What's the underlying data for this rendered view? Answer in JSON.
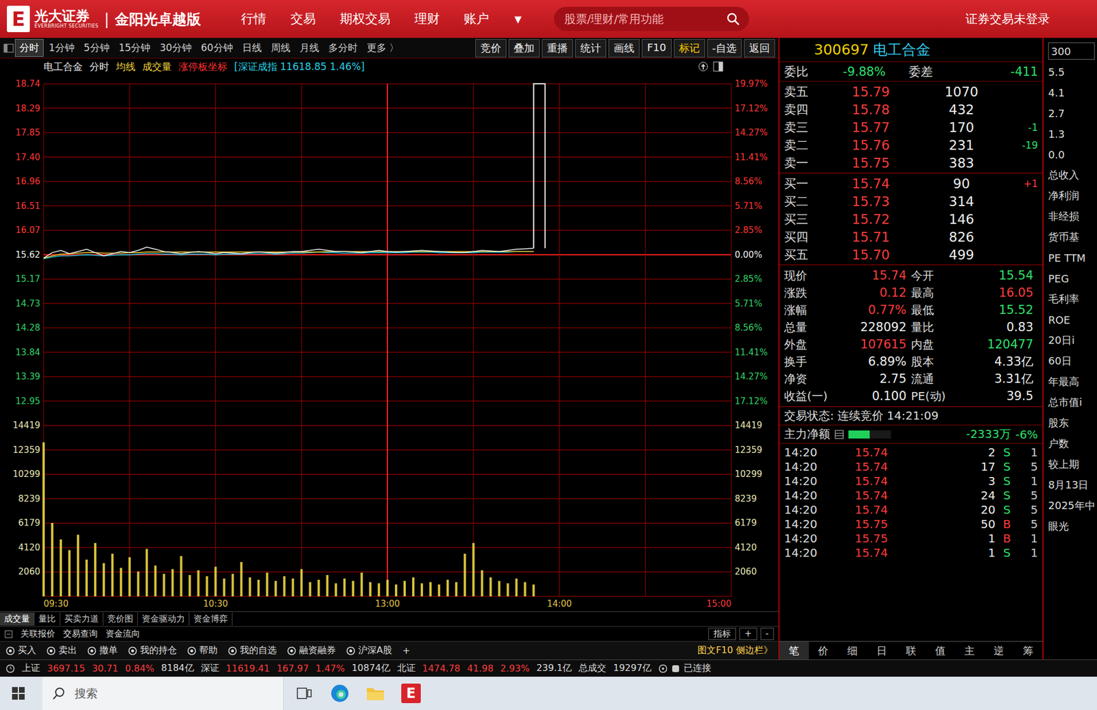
{
  "header": {
    "logo": "E",
    "brand": "光大证券",
    "brand_en": "EVERBRIGHT SECURITIES",
    "separator": "|",
    "edition": "金阳光卓越版",
    "menu": [
      "行情",
      "交易",
      "期权交易",
      "理财",
      "账户"
    ],
    "menu_arrow": "▼",
    "search": {
      "placeholder": "股票/理财/常用功能"
    },
    "login_status": "证券交易未登录"
  },
  "period_tabs": [
    {
      "label": "分时",
      "selected": true
    },
    {
      "label": "1分钟",
      "selected": false
    },
    {
      "label": "5分钟",
      "selected": false
    },
    {
      "label": "15分钟",
      "selected": false
    },
    {
      "label": "30分钟",
      "selected": false
    },
    {
      "label": "60分钟",
      "selected": false
    },
    {
      "label": "日线",
      "selected": false
    },
    {
      "label": "周线",
      "selected": false
    },
    {
      "label": "月线",
      "selected": false
    },
    {
      "label": "多分时",
      "selected": false
    },
    {
      "label": "更多 〉",
      "selected": false
    }
  ],
  "toolbar": [
    {
      "label": "竞价",
      "selected": false
    },
    {
      "label": "叠加",
      "selected": false
    },
    {
      "label": "重播",
      "selected": false
    },
    {
      "label": "统计",
      "selected": false
    },
    {
      "label": "画线",
      "selected": false
    },
    {
      "label": "F10",
      "selected": false
    },
    {
      "label": "标记",
      "selected": true
    },
    {
      "label": "-自选",
      "selected": false
    },
    {
      "label": "返回",
      "selected": false
    }
  ],
  "chart": {
    "legend": [
      {
        "text": "电工合金",
        "color": "#e6e6e6"
      },
      {
        "text": "分时",
        "color": "#e6e6e6"
      },
      {
        "text": "均线",
        "color": "#f0d23c"
      },
      {
        "text": "成交量",
        "color": "#f0d23c"
      },
      {
        "text": "涨停板坐标",
        "color": "#ff3030"
      },
      {
        "text": "[深证成指 11618.85 1.46%]",
        "color": "#2ad0e6"
      }
    ],
    "price_ticks": [
      "18.74",
      "18.29",
      "17.85",
      "17.40",
      "16.96",
      "16.51",
      "16.07",
      "15.62",
      "15.17",
      "14.73",
      "14.28",
      "13.84",
      "13.39",
      "12.95"
    ],
    "pct_ticks": [
      "19.97%",
      "17.12%",
      "14.27%",
      "11.41%",
      "8.56%",
      "5.71%",
      "2.85%",
      "0.00%",
      "2.85%",
      "5.71%",
      "8.56%",
      "11.41%",
      "14.27%",
      "17.12%"
    ],
    "volume_ticks": [
      "14419",
      "12359",
      "10299",
      "8239",
      "6179",
      "4120",
      "2060"
    ],
    "time_ticks": [
      "09:30",
      "10:30",
      "13:00",
      "14:00",
      "15:00"
    ],
    "series": {
      "price": [
        15.56,
        15.66,
        15.7,
        15.64,
        15.68,
        15.72,
        15.66,
        15.6,
        15.64,
        15.68,
        15.66,
        15.7,
        15.76,
        15.72,
        15.68,
        15.66,
        15.64,
        15.66,
        15.68,
        15.66,
        15.64,
        15.66,
        15.65,
        15.64,
        15.66,
        15.67,
        15.66,
        15.65,
        15.66,
        15.68,
        15.68,
        15.7,
        15.72,
        15.7,
        15.68,
        15.68,
        15.67,
        15.66,
        15.68,
        15.7,
        15.68,
        15.67,
        15.68,
        15.69,
        15.7,
        15.69,
        15.68,
        15.67,
        15.66,
        15.66,
        15.68,
        15.7,
        15.69,
        15.68,
        15.7,
        15.72,
        15.73,
        15.74
      ],
      "average": [
        15.56,
        15.6,
        15.63,
        15.64,
        15.65,
        15.66,
        15.66,
        15.65,
        15.65,
        15.65,
        15.66,
        15.66,
        15.67,
        15.67,
        15.67,
        15.67,
        15.67,
        15.67,
        15.67,
        15.67,
        15.67,
        15.67,
        15.67,
        15.67,
        15.67,
        15.67,
        15.67,
        15.67,
        15.67,
        15.67,
        15.67,
        15.67,
        15.67,
        15.68,
        15.68,
        15.68,
        15.68,
        15.68,
        15.68,
        15.68,
        15.68,
        15.68,
        15.68,
        15.68,
        15.68,
        15.68,
        15.68,
        15.68,
        15.68,
        15.68,
        15.68,
        15.68,
        15.68,
        15.68,
        15.68,
        15.68,
        15.68,
        15.68
      ],
      "index_overlay": [
        15.55,
        15.58,
        15.6,
        15.6,
        15.61,
        15.62,
        15.61,
        15.6,
        15.61,
        15.62,
        15.62,
        15.63,
        15.64,
        15.64,
        15.63,
        15.63,
        15.62,
        15.63,
        15.63,
        15.63,
        15.62,
        15.63,
        15.63,
        15.63,
        15.64,
        15.64,
        15.64,
        15.63,
        15.64,
        15.65,
        15.65,
        15.66,
        15.67,
        15.66,
        15.66,
        15.65,
        15.65,
        15.65,
        15.66,
        15.66,
        15.66,
        15.66,
        15.66,
        15.67,
        15.67,
        15.67,
        15.66,
        15.66,
        15.66,
        15.66,
        15.66,
        15.67,
        15.67,
        15.67,
        15.67,
        15.68,
        15.68,
        15.68
      ],
      "volume": [
        13000,
        6200,
        4800,
        3900,
        5200,
        3100,
        4500,
        2800,
        3600,
        2400,
        3300,
        2100,
        4000,
        2600,
        1900,
        2300,
        3400,
        1800,
        2200,
        1700,
        2500,
        1500,
        1900,
        2900,
        1600,
        1400,
        2000,
        1300,
        1700,
        1500,
        2300,
        1200,
        1400,
        1800,
        1100,
        1500,
        1300,
        2000,
        1200,
        1100,
        1400,
        1000,
        1300,
        1600,
        1100,
        1200,
        1000,
        1400,
        1200,
        3600,
        4500,
        2200,
        1600,
        1300,
        1100,
        1500,
        1200,
        1000
      ]
    },
    "spike": [
      15.74,
      18.74,
      18.74,
      15.74
    ]
  },
  "indicator_tabs": [
    {
      "label": "成交量",
      "selected": true
    },
    {
      "label": "量比",
      "selected": false
    },
    {
      "label": "买卖力道",
      "selected": false
    },
    {
      "label": "竞价图",
      "selected": false
    },
    {
      "label": "资金驱动力",
      "selected": false
    },
    {
      "label": "资金博弈",
      "selected": false
    }
  ],
  "links": [
    "关联报价",
    "交易查询",
    "资金流向"
  ],
  "indicator_controls": [
    "指标",
    "+",
    "-"
  ],
  "actions": [
    "买入",
    "卖出",
    "撤单",
    "我的持仓",
    "帮助",
    "我的自选",
    "融资融券",
    "沪深A股"
  ],
  "actions_add": "+",
  "side_toggle": "图文F10 侧边栏》",
  "quote": {
    "code": "300697",
    "name": "电工合金",
    "ratio_label": "委比",
    "ratio": "-9.88%",
    "diff_label": "委差",
    "diff": "-411",
    "asks": [
      {
        "label": "卖五",
        "price": "15.79",
        "volume": "1070",
        "change": ""
      },
      {
        "label": "卖四",
        "price": "15.78",
        "volume": "432",
        "change": ""
      },
      {
        "label": "卖三",
        "price": "15.77",
        "volume": "170",
        "change": "-1"
      },
      {
        "label": "卖二",
        "price": "15.76",
        "volume": "231",
        "change": "-19"
      },
      {
        "label": "卖一",
        "price": "15.75",
        "volume": "383",
        "change": ""
      }
    ],
    "bids": [
      {
        "label": "买一",
        "price": "15.74",
        "volume": "90",
        "change": "+1"
      },
      {
        "label": "买二",
        "price": "15.73",
        "volume": "314",
        "change": ""
      },
      {
        "label": "买三",
        "price": "15.72",
        "volume": "146",
        "change": ""
      },
      {
        "label": "买四",
        "price": "15.71",
        "volume": "826",
        "change": ""
      },
      {
        "label": "买五",
        "price": "15.70",
        "volume": "499",
        "change": ""
      }
    ],
    "stats": [
      {
        "label": "现价",
        "value": "15.74",
        "color": "#ff3b3b"
      },
      {
        "label": "今开",
        "value": "15.54",
        "color": "#2ee06a"
      },
      {
        "label": "涨跌",
        "value": "0.12",
        "color": "#ff3b3b"
      },
      {
        "label": "最高",
        "value": "16.05",
        "color": "#ff3b3b"
      },
      {
        "label": "涨幅",
        "value": "0.77%",
        "color": "#ff3b3b"
      },
      {
        "label": "最低",
        "value": "15.52",
        "color": "#2ee06a"
      },
      {
        "label": "总量",
        "value": "228092",
        "color": "#eeeeee"
      },
      {
        "label": "量比",
        "value": "0.83",
        "color": "#eeeeee"
      },
      {
        "label": "外盘",
        "value": "107615",
        "color": "#ff3b3b"
      },
      {
        "label": "内盘",
        "value": "120477",
        "color": "#2ee06a"
      },
      {
        "label": "换手",
        "value": "6.89%",
        "color": "#eeeeee"
      },
      {
        "label": "股本",
        "value": "4.33亿",
        "color": "#eeeeee"
      },
      {
        "label": "净资",
        "value": "2.75",
        "color": "#eeeeee"
      },
      {
        "label": "流通",
        "value": "3.31亿",
        "color": "#eeeeee"
      },
      {
        "label": "收益(一)",
        "value": "0.100",
        "color": "#eeeeee"
      },
      {
        "label": "PE(动)",
        "value": "39.5",
        "color": "#eeeeee"
      }
    ],
    "trade_state": {
      "label": "交易状态:",
      "value": "连续竞价 14:21:09"
    },
    "main_flow": {
      "label": "主力净额",
      "level": 0.5,
      "amount": "-2333万",
      "pct": "-6%"
    },
    "ticks": [
      {
        "time": "14:20",
        "price": "15.74",
        "volume": "2",
        "side": "S",
        "count": "1"
      },
      {
        "time": "14:20",
        "price": "15.74",
        "volume": "17",
        "side": "S",
        "count": "5"
      },
      {
        "time": "14:20",
        "price": "15.74",
        "volume": "3",
        "side": "S",
        "count": "1"
      },
      {
        "time": "14:20",
        "price": "15.74",
        "volume": "24",
        "side": "S",
        "count": "5"
      },
      {
        "time": "14:20",
        "price": "15.74",
        "volume": "20",
        "side": "S",
        "count": "5"
      },
      {
        "time": "14:20",
        "price": "15.75",
        "volume": "50",
        "side": "B",
        "count": "5"
      },
      {
        "time": "14:20",
        "price": "15.75",
        "volume": "1",
        "side": "B",
        "count": "1"
      },
      {
        "time": "14:20",
        "price": "15.74",
        "volume": "1",
        "side": "S",
        "count": "1"
      }
    ],
    "tabs": [
      {
        "label": "笔",
        "selected": true
      },
      {
        "label": "价",
        "selected": false
      },
      {
        "label": "细",
        "selected": false
      },
      {
        "label": "日",
        "selected": false
      },
      {
        "label": "联",
        "selected": false
      },
      {
        "label": "值",
        "selected": false
      },
      {
        "label": "主",
        "selected": false
      },
      {
        "label": "逆",
        "selected": false
      },
      {
        "label": "筹",
        "selected": false
      }
    ]
  },
  "side": {
    "items": [
      "300",
      "5.5",
      "4.1",
      "2.7",
      "1.3",
      "0.0",
      "总收入",
      "净利润",
      "非经损",
      "货币基",
      "PE TTM",
      "PEG",
      "毛利率",
      "ROE",
      "20日i",
      "60日",
      "年最高",
      "总市值i",
      "股东",
      "户数",
      "较上期",
      "8月13日",
      "2025年中",
      "眼光"
    ]
  },
  "status_bar": {
    "indices": [
      {
        "name": "上证",
        "value": "3697.15",
        "change": "30.71",
        "pct": "0.84%",
        "turnover": "8184亿"
      },
      {
        "name": "深证",
        "value": "11619.41",
        "change": "167.97",
        "pct": "1.47%",
        "turnover": "10874亿"
      },
      {
        "name": "北证",
        "value": "1474.78",
        "change": "41.98",
        "pct": "2.93%",
        "turnover": "239.1亿"
      }
    ],
    "total_label": "总成交",
    "total": "19297亿",
    "connection": "已连接"
  },
  "taskbar": {
    "search": {
      "placeholder": "搜索"
    },
    "app_label": "E"
  }
}
